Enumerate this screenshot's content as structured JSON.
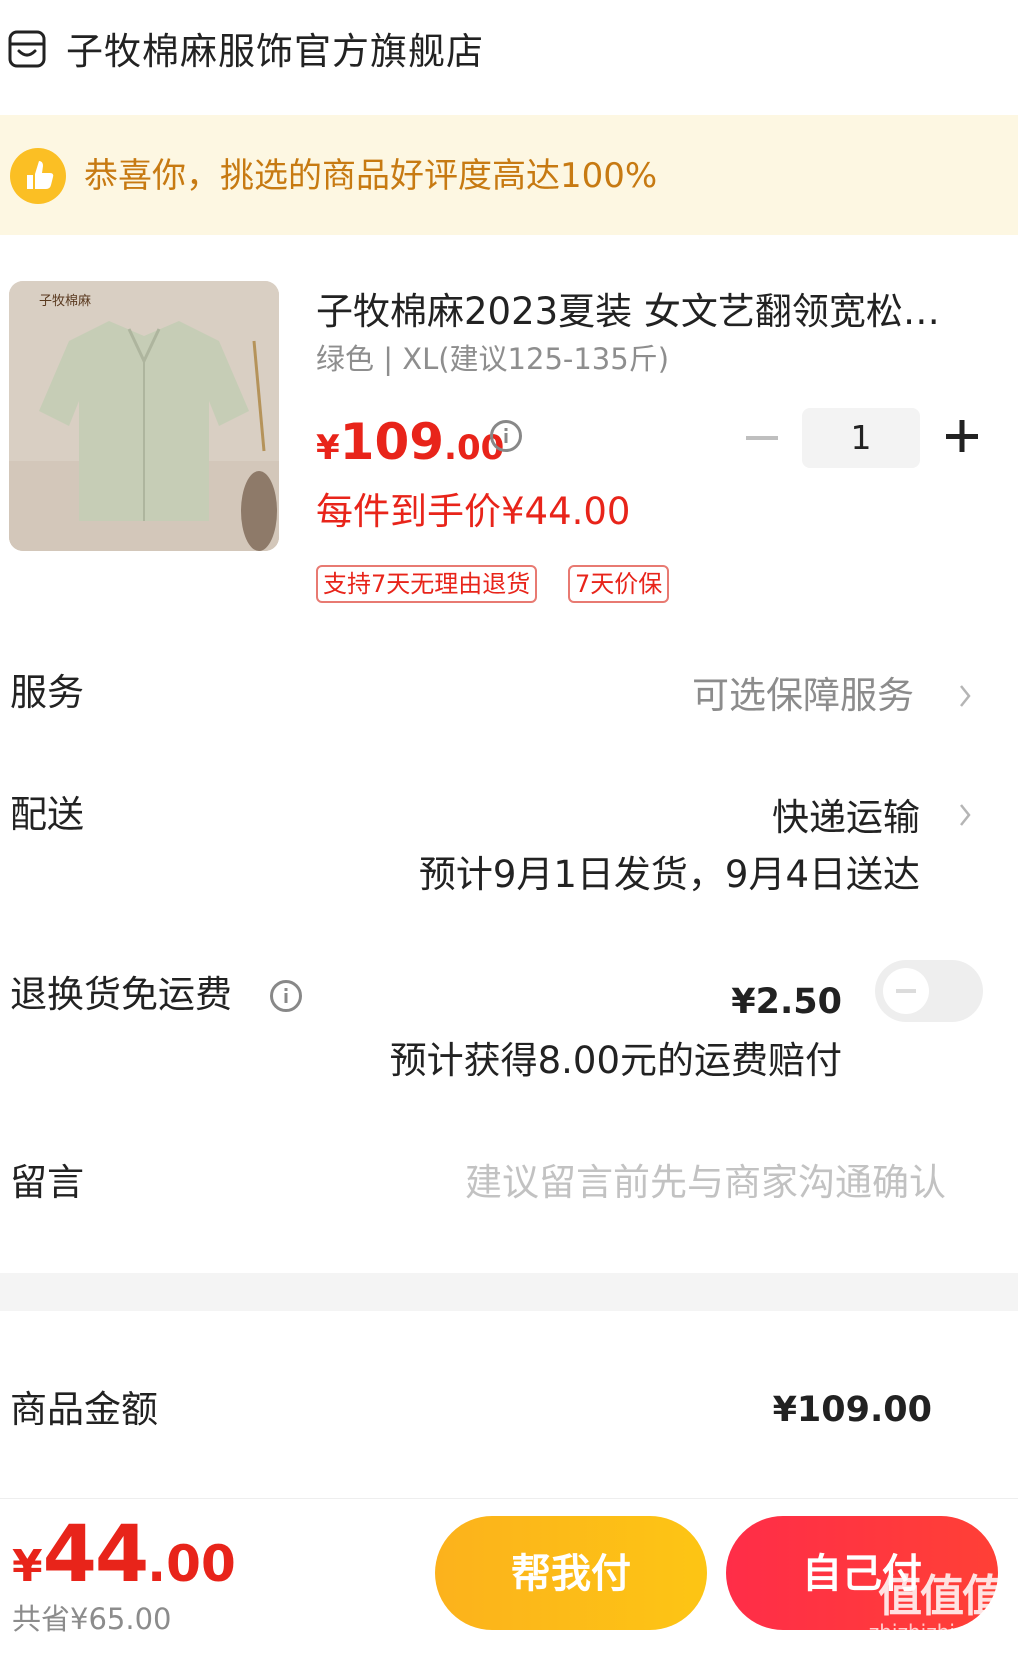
{
  "store": {
    "name": "子牧棉麻服饰官方旗舰店",
    "icon": "store-icon"
  },
  "banner": {
    "text": "恭喜你，挑选的商品好评度高达100%",
    "icon": "thumbs-up-icon"
  },
  "product": {
    "image_label": "子牧棉麻",
    "title": "子牧棉麻2023夏装 女文艺翻领宽松…",
    "spec": "绿色 | XL(建议125-135斤)",
    "price_currency": "¥",
    "price_int": "109",
    "price_dec": ".00",
    "quantity": "1",
    "final_price": "每件到手价¥44.00",
    "tags": [
      "支持7天无理由退货",
      "7天价保"
    ]
  },
  "service": {
    "label": "服务",
    "value": "可选保障服务"
  },
  "shipping": {
    "label": "配送",
    "method": "快递运输",
    "eta": "预计9月1日发货，9月4日送达"
  },
  "return_insurance": {
    "label": "退换货免运费",
    "price": "¥2.50",
    "note": "预计获得8.00元的运费赔付",
    "enabled": false
  },
  "message": {
    "label": "留言",
    "placeholder": "建议留言前先与商家沟通确认"
  },
  "amount": {
    "label": "商品金额",
    "value": "¥109.00"
  },
  "checkout": {
    "currency": "¥",
    "total_int": "44",
    "total_dec": ".00",
    "saved": "共省¥65.00",
    "help_pay_label": "帮我付",
    "self_pay_label": "自己付"
  },
  "watermark": {
    "text": "值值值",
    "sub": "zhizhizhi.com"
  },
  "colors": {
    "accent": "#e8241a",
    "help_btn": "#fcb21c",
    "self_btn": "#ff3340",
    "banner_bg": "#fdf7e2",
    "banner_text": "#c77a12"
  }
}
